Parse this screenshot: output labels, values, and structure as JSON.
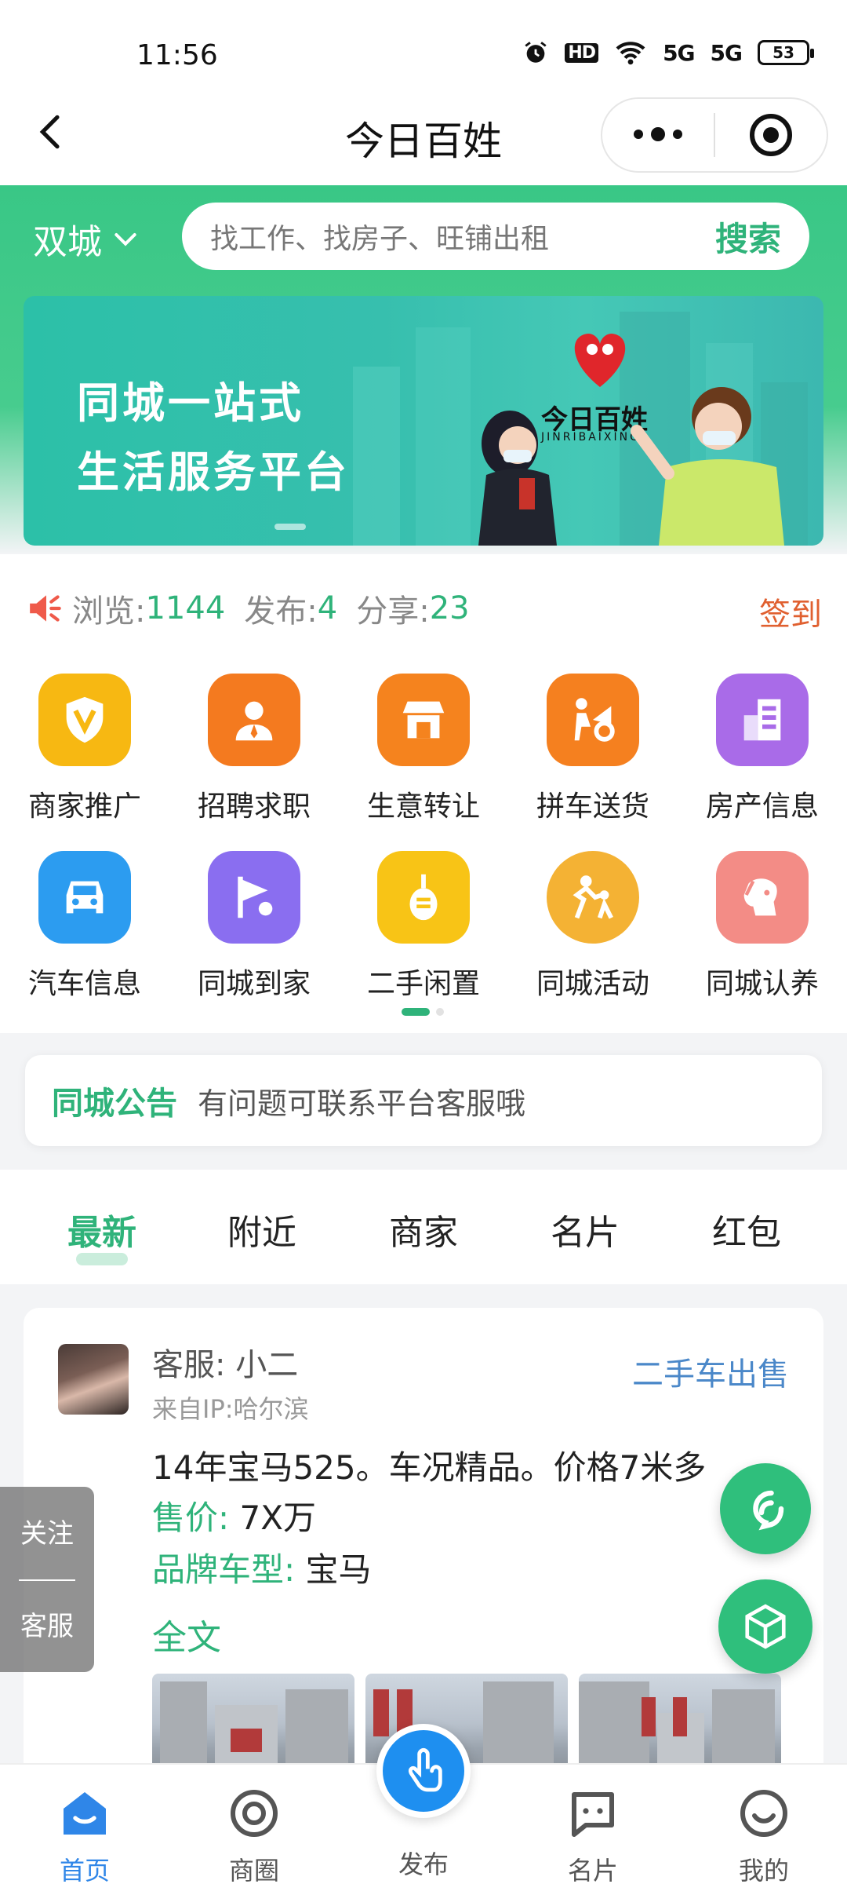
{
  "status_bar": {
    "time": "11:56",
    "hd": "HD",
    "net1": "5G",
    "net2": "5G",
    "battery": "53"
  },
  "header": {
    "title": "今日百姓"
  },
  "search": {
    "city": "双城",
    "placeholder": "找工作、找房子、旺铺出租",
    "button": "搜索"
  },
  "banner": {
    "line1": "同城一站式",
    "line2": "生活服务平台",
    "brand": "今日百姓",
    "brand_sub": "JINRIBAIXING"
  },
  "stats": {
    "views_label": "浏览:",
    "views": "1144",
    "posts_label": "发布:",
    "posts": "4",
    "shares_label": "分享:",
    "shares": "23",
    "signin": "签到"
  },
  "categories": [
    {
      "label": "商家推广",
      "icon": "merchant-promo-icon",
      "color": "#f7b812"
    },
    {
      "label": "招聘求职",
      "icon": "recruit-icon",
      "color": "#f47a1f"
    },
    {
      "label": "生意转让",
      "icon": "shop-transfer-icon",
      "color": "#f5831e"
    },
    {
      "label": "拼车送货",
      "icon": "carpool-icon",
      "color": "#f5801f"
    },
    {
      "label": "房产信息",
      "icon": "building-icon",
      "color": "#a96be8"
    },
    {
      "label": "汽车信息",
      "icon": "car-icon",
      "color": "#2c9cf0"
    },
    {
      "label": "同城到家",
      "icon": "flag-location-icon",
      "color": "#8a6ef0"
    },
    {
      "label": "二手闲置",
      "icon": "pipa-icon",
      "color": "#f8c416"
    },
    {
      "label": "同城活动",
      "icon": "people-activity-icon",
      "color": "#f4b234"
    },
    {
      "label": "同城认养",
      "icon": "dog-icon",
      "color": "#f38c86"
    }
  ],
  "notice": {
    "title": "同城公告",
    "text": "有问题可联系平台客服哦"
  },
  "tabs": [
    "最新",
    "附近",
    "商家",
    "名片",
    "红包"
  ],
  "post": {
    "author": "客服: 小二",
    "ip": "来自IP:哈尔滨",
    "category": "二手车出售",
    "content": "14年宝马525。车况精品。价格7米多",
    "price_label": "售价:",
    "price_value": "7X万",
    "brand_label": "品牌车型:",
    "brand_value": "宝马",
    "full_text": "全文"
  },
  "side": {
    "follow": "关注",
    "service": "客服"
  },
  "bottom_nav": {
    "home": "首页",
    "circle": "商圈",
    "publish": "发布",
    "card": "名片",
    "mine": "我的"
  },
  "colors": {
    "green": "#2fb37a",
    "blue": "#2f86e8"
  }
}
